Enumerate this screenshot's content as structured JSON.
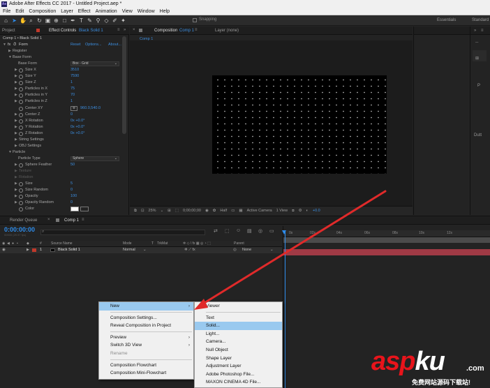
{
  "window": {
    "title": "Adobe After Effects CC 2017 - Untitled Project.aep *",
    "logo": "Ae"
  },
  "menubar": [
    "File",
    "Edit",
    "Composition",
    "Layer",
    "Effect",
    "Animation",
    "View",
    "Window",
    "Help"
  ],
  "toolbar": {
    "snapping_label": "Snapping",
    "workspaces": [
      "Essentials",
      "Standard"
    ]
  },
  "project_panel": {
    "tab": "Project"
  },
  "effect_controls": {
    "tab_label": "Effect Controls",
    "tab_layer": "Black Solid 1",
    "breadcrumb": "Comp 1 • Black Solid 1",
    "effect_name": "Form",
    "reset": "Reset",
    "options": "Options...",
    "about": "About...",
    "rows": {
      "register": "Register",
      "base_form_group": "Base Form",
      "base_form": {
        "label": "Base Form",
        "value": "Box - Grid"
      },
      "size_x": {
        "label": "Size X",
        "value": "3510"
      },
      "size_y": {
        "label": "Size Y",
        "value": "7590"
      },
      "size_z": {
        "label": "Size Z",
        "value": "1"
      },
      "particles_x": {
        "label": "Particles in X",
        "value": "75"
      },
      "particles_y": {
        "label": "Particles in Y",
        "value": "70"
      },
      "particles_z": {
        "label": "Particles in Z",
        "value": "1"
      },
      "center_xy": {
        "label": "Center XY",
        "value": "960.0,540.0"
      },
      "center_z": {
        "label": "Center Z",
        "value": "0"
      },
      "x_rotation": {
        "label": "X Rotation",
        "value": "0x +0.0°"
      },
      "y_rotation": {
        "label": "Y Rotation",
        "value": "0x +0.0°"
      },
      "z_rotation": {
        "label": "Z Rotation",
        "value": "0x +0.0°"
      },
      "string_settings": "String Settings",
      "obj_settings": "OBJ Settings",
      "particle_group": "Particle",
      "particle_type": {
        "label": "Particle Type",
        "value": "Sphere"
      },
      "sphere_feather": {
        "label": "Sphere Feather",
        "value": "50"
      },
      "texture": "Texture",
      "rotation": "Rotation",
      "size": {
        "label": "Size",
        "value": "5"
      },
      "size_random": {
        "label": "Size Random",
        "value": "0"
      },
      "opacity": {
        "label": "Opacity",
        "value": "100"
      },
      "opacity_random": {
        "label": "Opacity Random",
        "value": "0"
      },
      "color": {
        "label": "Color"
      }
    }
  },
  "composition": {
    "tab_label": "Composition",
    "tab_comp": "Comp 1",
    "layer_tab": "Layer (none)",
    "sub_tab": "Comp 1",
    "bottom": {
      "zoom": "25%",
      "time": "0;00;00;00",
      "resolution": "Half",
      "camera": "Active Camera",
      "views": "1 View",
      "exposure": "+0.0"
    }
  },
  "right_panel": {
    "letters": [
      "P",
      "Dutt"
    ]
  },
  "timeline": {
    "tabs": [
      "Render Queue",
      "Comp 1"
    ],
    "timecode": "0:00:00:00",
    "fps": "00000 (29.97 fps)",
    "columns": {
      "num": "#",
      "source": "Source Name",
      "mode": "Mode",
      "t": "T",
      "trkmat": "TrkMat",
      "parent": "Parent"
    },
    "layer": {
      "num": "1",
      "name": "Black Solid 1",
      "mode": "Normal",
      "parent": "None"
    },
    "ruler": [
      "0s",
      "02s",
      "04s",
      "06s",
      "08s",
      "10s",
      "12s"
    ]
  },
  "context_menu": {
    "items": [
      "New",
      "Composition Settings...",
      "Reveal Composition in Project",
      "Preview",
      "Switch 3D View",
      "Rename",
      "Composition Flowchart",
      "Composition Mini-Flowchart"
    ],
    "disabled": [
      "Rename"
    ],
    "highlighted": "New"
  },
  "submenu": {
    "items": [
      "Viewer",
      "Text",
      "Solid...",
      "Light...",
      "Camera...",
      "Null Object",
      "Shape Layer",
      "Adjustment Layer",
      "Adobe Photoshop File...",
      "MAXON CINEMA 4D File..."
    ],
    "highlighted": "Solid..."
  },
  "watermark": {
    "brand_asp": "asp",
    "brand_ku": "ku",
    "domain": ".com",
    "subtitle": "免费网站源码下载站!"
  },
  "colors": {
    "accent_blue": "#2d8ceb",
    "layer_red": "#a03a45",
    "menu_highlight": "#99c9ef",
    "arrow_red": "#e02a2a"
  }
}
